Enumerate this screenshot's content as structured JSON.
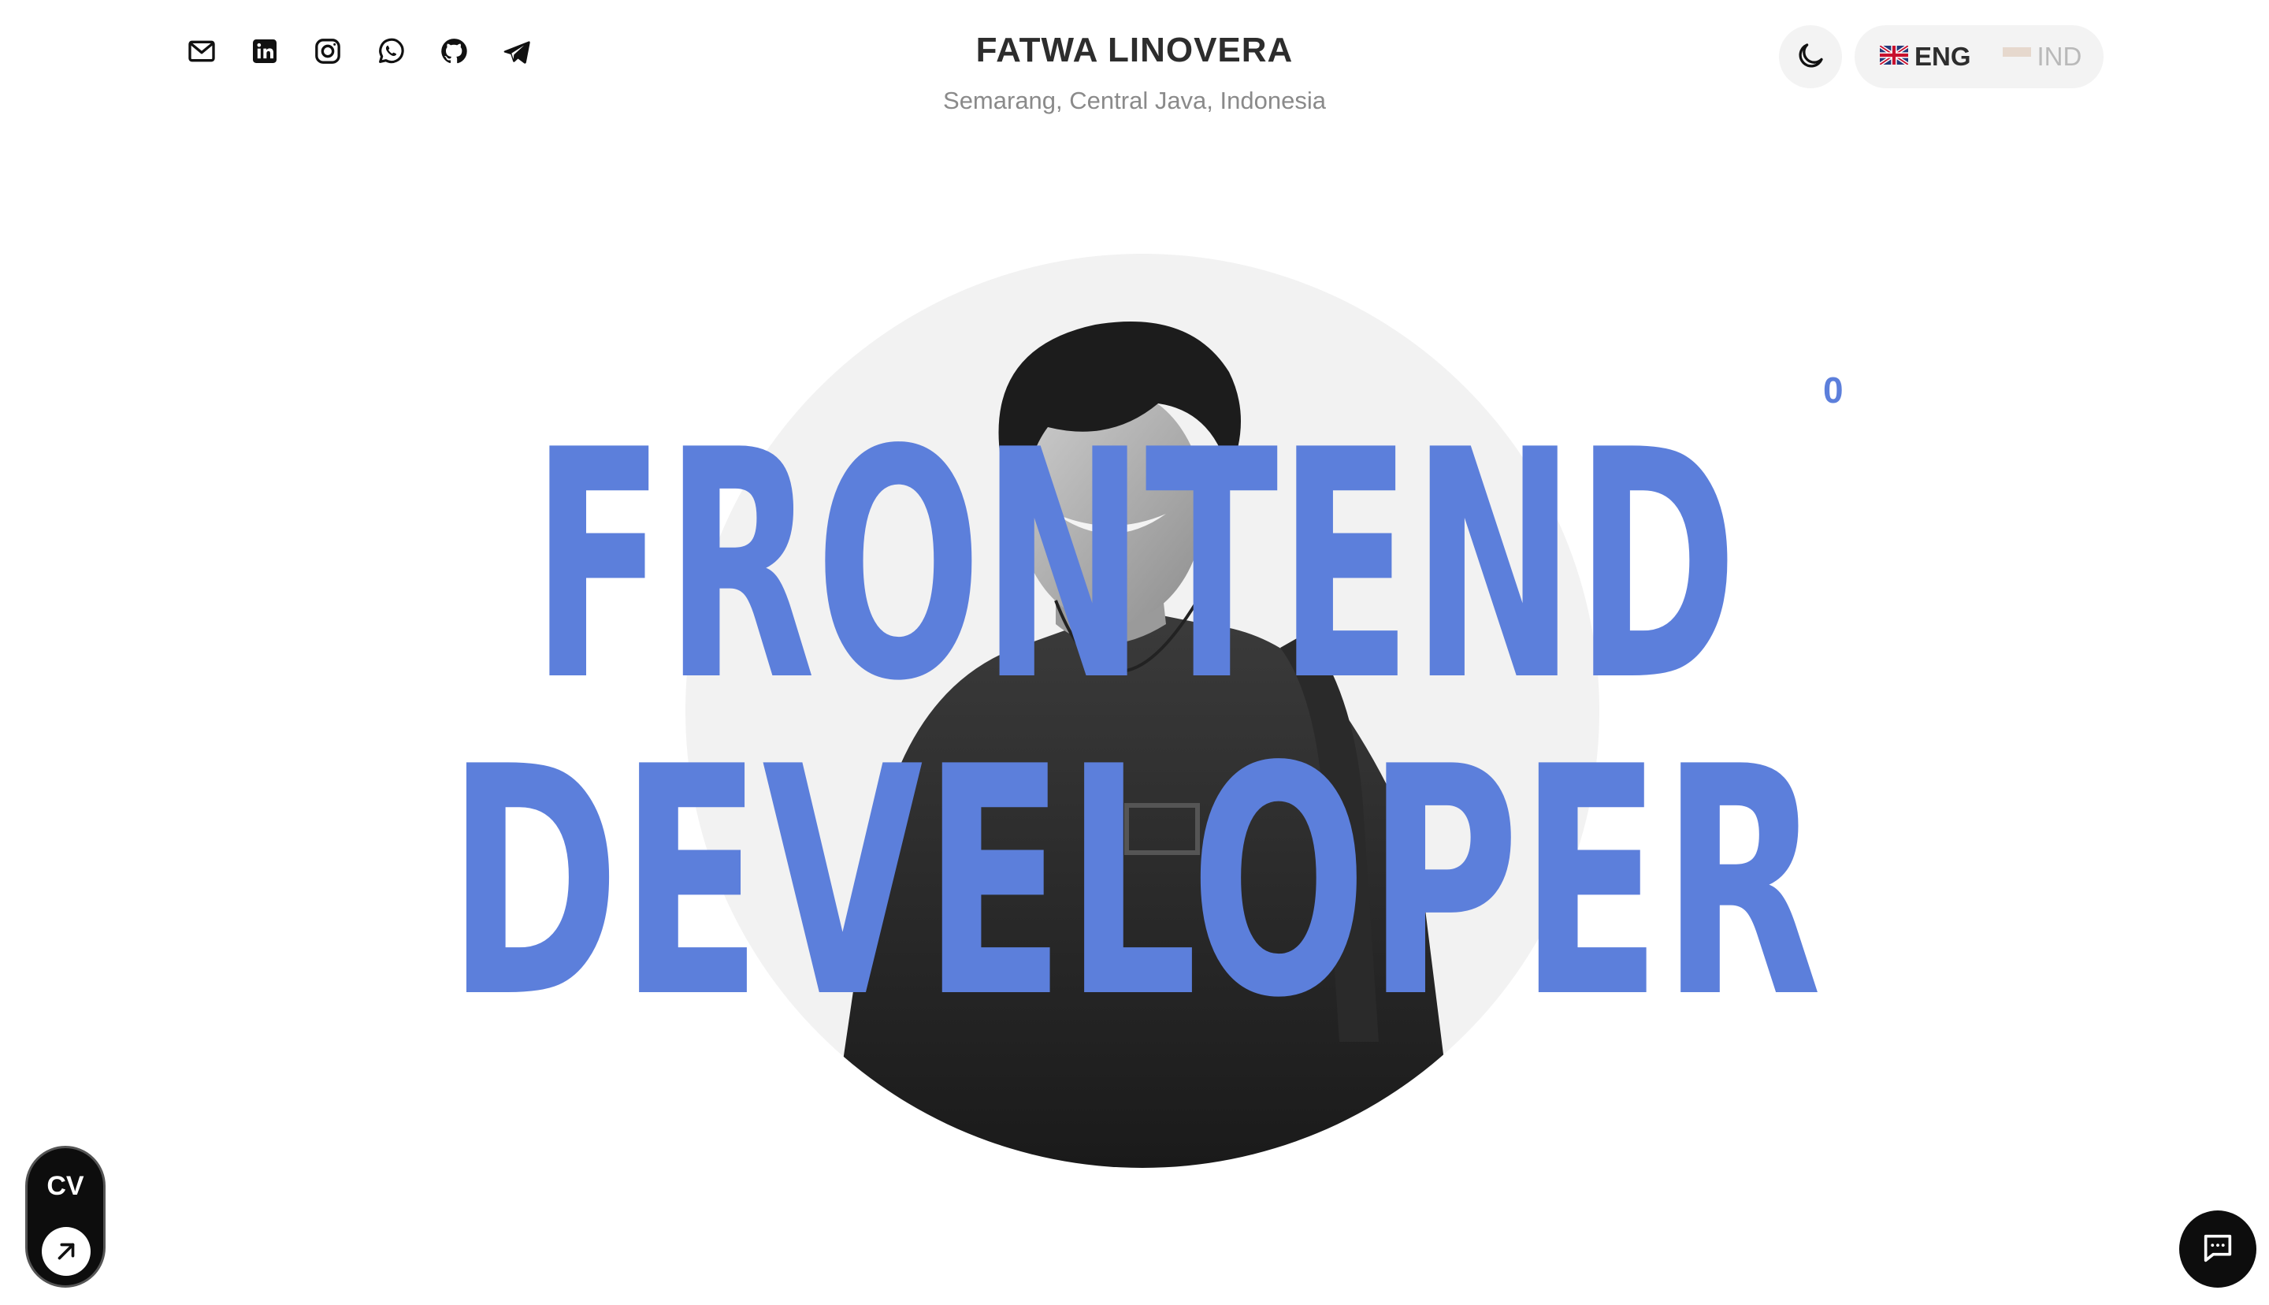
{
  "header": {
    "name": "FATWA LINOVERA",
    "location": "Semarang, Central Java, Indonesia",
    "social_links": [
      {
        "icon": "mail-icon"
      },
      {
        "icon": "linkedin-icon"
      },
      {
        "icon": "instagram-icon"
      },
      {
        "icon": "whatsapp-icon"
      },
      {
        "icon": "github-icon"
      },
      {
        "icon": "telegram-icon"
      }
    ],
    "theme_toggle_icon": "moon-icon",
    "languages": [
      {
        "label": "ENG",
        "flag": "uk-flag-icon",
        "active": true
      },
      {
        "label": "IND",
        "flag": "indonesia-flag-icon",
        "active": false
      }
    ]
  },
  "hero": {
    "line1": "FRONTEND",
    "line2": "DEVELOPER",
    "counter": "0",
    "accent_color": "#5c7fdb"
  },
  "floating": {
    "cv_label": "CV",
    "cv_icon": "arrow-up-right-icon",
    "chat_icon": "chat-icon"
  }
}
